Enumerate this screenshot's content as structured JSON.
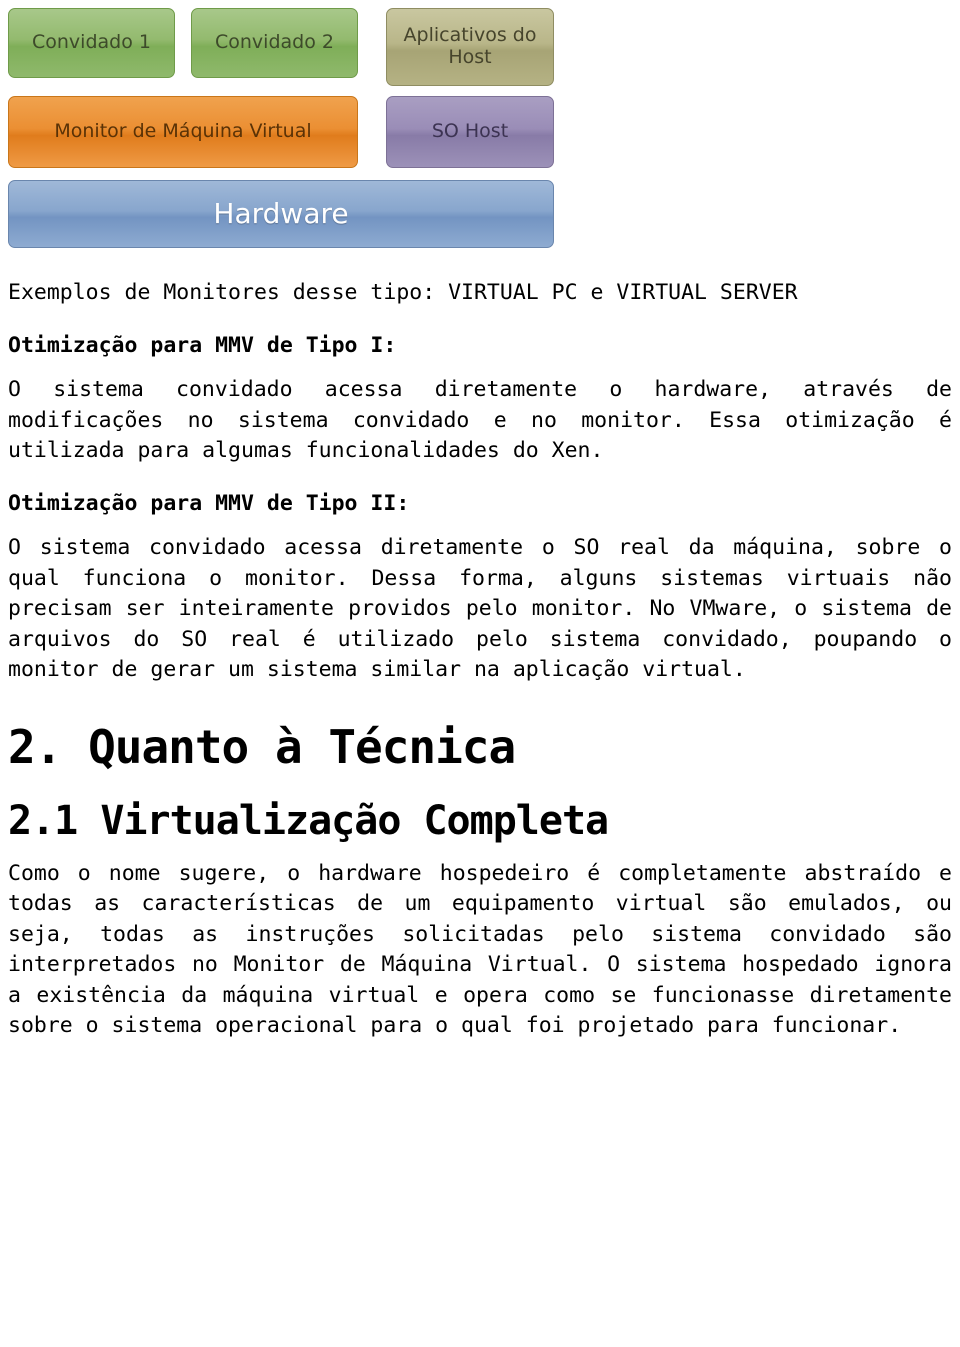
{
  "diagram": {
    "guest1": "Convidado 1",
    "guest2": "Convidado 2",
    "host_apps_line1": "Aplicativos do",
    "host_apps_line2": "Host",
    "vmm": "Monitor de Máquina Virtual",
    "host_os": "SO Host",
    "hardware": "Hardware"
  },
  "content": {
    "examples_line": "Exemplos de Monitores desse tipo: VIRTUAL PC e VIRTUAL SERVER",
    "opt_type1_heading": "Otimização para MMV de Tipo I:",
    "opt_type1_body": "O sistema convidado acessa diretamente o hardware, através de modificações no sistema convidado e no monitor. Essa otimização é utilizada para algumas funcionalidades do Xen.",
    "opt_type2_heading": "Otimização para MMV de Tipo II:",
    "opt_type2_body": "O sistema convidado acessa diretamente o SO real da máquina, sobre o qual funciona o monitor. Dessa forma, alguns sistemas virtuais não precisam ser inteiramente providos pelo monitor. No VMware, o sistema de arquivos do SO real é utilizado pelo sistema convidado, poupando o monitor de gerar um sistema similar na aplicação virtual.",
    "section_2_title": "2. Quanto à Técnica",
    "section_21_title": "2.1 Virtualização Completa",
    "section_21_body": "Como o nome sugere, o hardware hospedeiro é completamente abstraído e todas as características de um equipamento virtual são emulados, ou seja, todas as instruções solicitadas pelo sistema convidado são interpretados no Monitor de Máquina Virtual. O sistema hospedado ignora a existência da máquina virtual e opera como se funcionasse diretamente sobre o sistema operacional para o qual foi projetado para funcionar."
  }
}
